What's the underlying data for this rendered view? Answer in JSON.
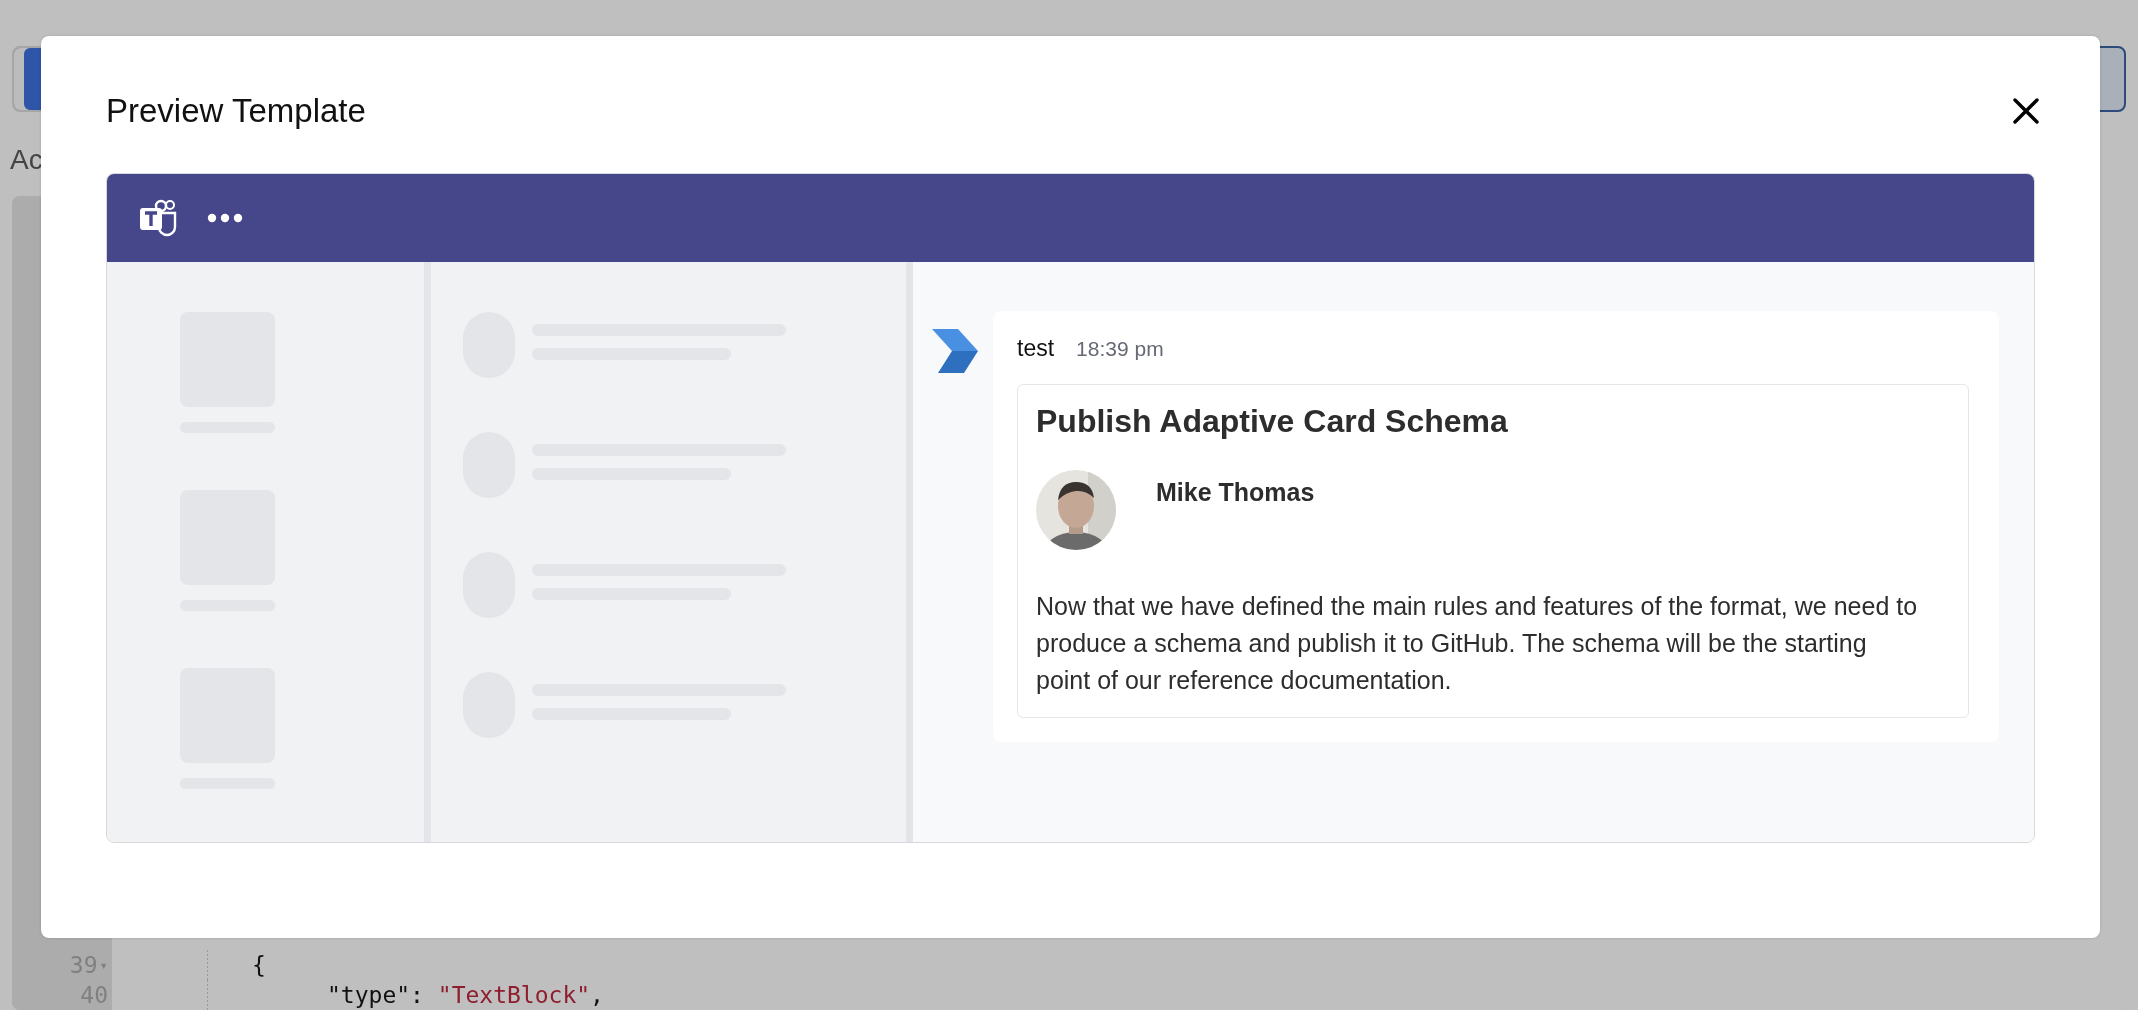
{
  "background_page": {
    "label": "Ac",
    "editor_lines": [
      {
        "number": "39",
        "fold_marker": "▾",
        "tokens": [
          {
            "kind": "plain",
            "text": "{"
          }
        ]
      },
      {
        "number": "40",
        "tokens": [
          {
            "kind": "plain",
            "text": "\"type\": "
          },
          {
            "kind": "string",
            "text": "\"TextBlock\""
          },
          {
            "kind": "plain",
            "text": ","
          }
        ]
      }
    ]
  },
  "dialog": {
    "title": "Preview Template",
    "teams_preview": {
      "rail_items": [
        {
          "kind": "placeholder"
        },
        {
          "kind": "placeholder"
        },
        {
          "kind": "placeholder"
        }
      ],
      "list_items": [
        {
          "kind": "placeholder"
        },
        {
          "kind": "placeholder"
        },
        {
          "kind": "placeholder"
        },
        {
          "kind": "placeholder"
        }
      ],
      "message": {
        "sender": "test",
        "time": "18:39 pm",
        "card": {
          "title": "Publish Adaptive Card Schema",
          "author": {
            "name": "Mike Thomas"
          },
          "body": "Now that we have defined the main rules and features of the format, we need to produce a schema and publish it to GitHub. The schema will be the starting point of our reference documentation."
        }
      }
    }
  }
}
